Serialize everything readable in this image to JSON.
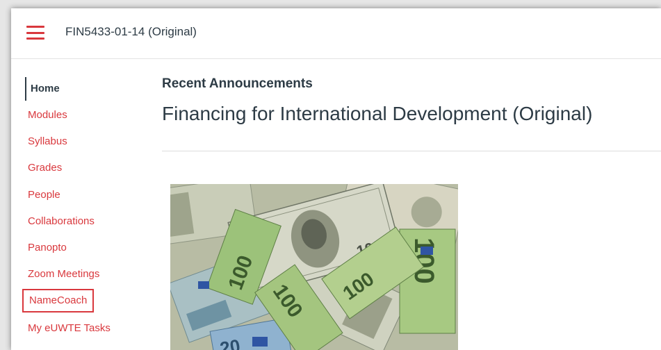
{
  "header": {
    "course_title": "FIN5433-01-14 (Original)",
    "menu_icon": "hamburger-icon"
  },
  "sidebar": {
    "items": [
      {
        "label": "Home",
        "active": true
      },
      {
        "label": "Modules"
      },
      {
        "label": "Syllabus"
      },
      {
        "label": "Grades"
      },
      {
        "label": "People"
      },
      {
        "label": "Collaborations"
      },
      {
        "label": "Panopto"
      },
      {
        "label": "Zoom Meetings"
      },
      {
        "label": "NameCoach",
        "highlighted": true
      },
      {
        "label": "My eUWTE Tasks"
      }
    ]
  },
  "main": {
    "recent_announcements": "Recent Announcements",
    "title": "Financing for International Development (Original)"
  },
  "banknotes": {
    "labels": [
      "100",
      "100",
      "100",
      "100",
      "20",
      "100",
      "100"
    ]
  },
  "colors": {
    "link": "#d9383d",
    "text": "#2d3b45",
    "highlight_border": "#d9383d"
  }
}
